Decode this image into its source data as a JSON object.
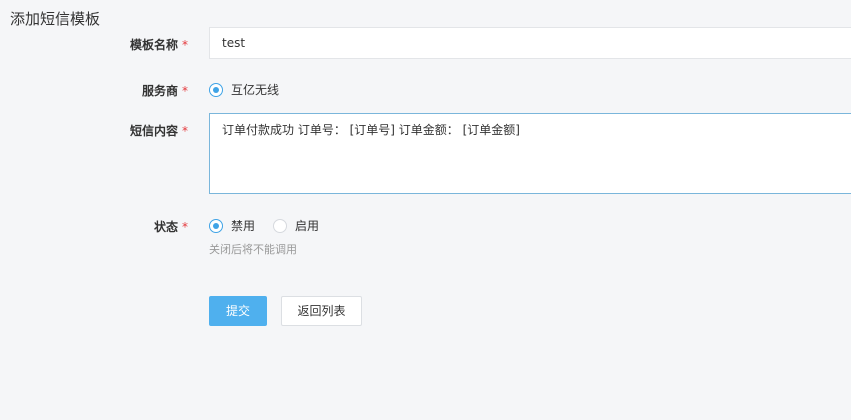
{
  "page": {
    "title": "添加短信模板"
  },
  "form": {
    "name": {
      "label": "模板名称",
      "required_mark": "*",
      "value": "test"
    },
    "provider": {
      "label": "服务商",
      "required_mark": "*",
      "options": [
        {
          "label": "互亿无线",
          "checked": true
        }
      ]
    },
    "content": {
      "label": "短信内容",
      "required_mark": "*",
      "value": "订单付款成功 订单号： [订单号] 订单金额： [订单金额]"
    },
    "status": {
      "label": "状态",
      "required_mark": "*",
      "options": [
        {
          "label": "禁用",
          "checked": true
        },
        {
          "label": "启用",
          "checked": false
        }
      ],
      "hint": "关闭后将不能调用"
    }
  },
  "actions": {
    "submit_label": "提交",
    "back_label": "返回列表"
  },
  "colors": {
    "accent": "#4fb0ee",
    "required": "#e4393c",
    "background": "#f5f6f8"
  }
}
